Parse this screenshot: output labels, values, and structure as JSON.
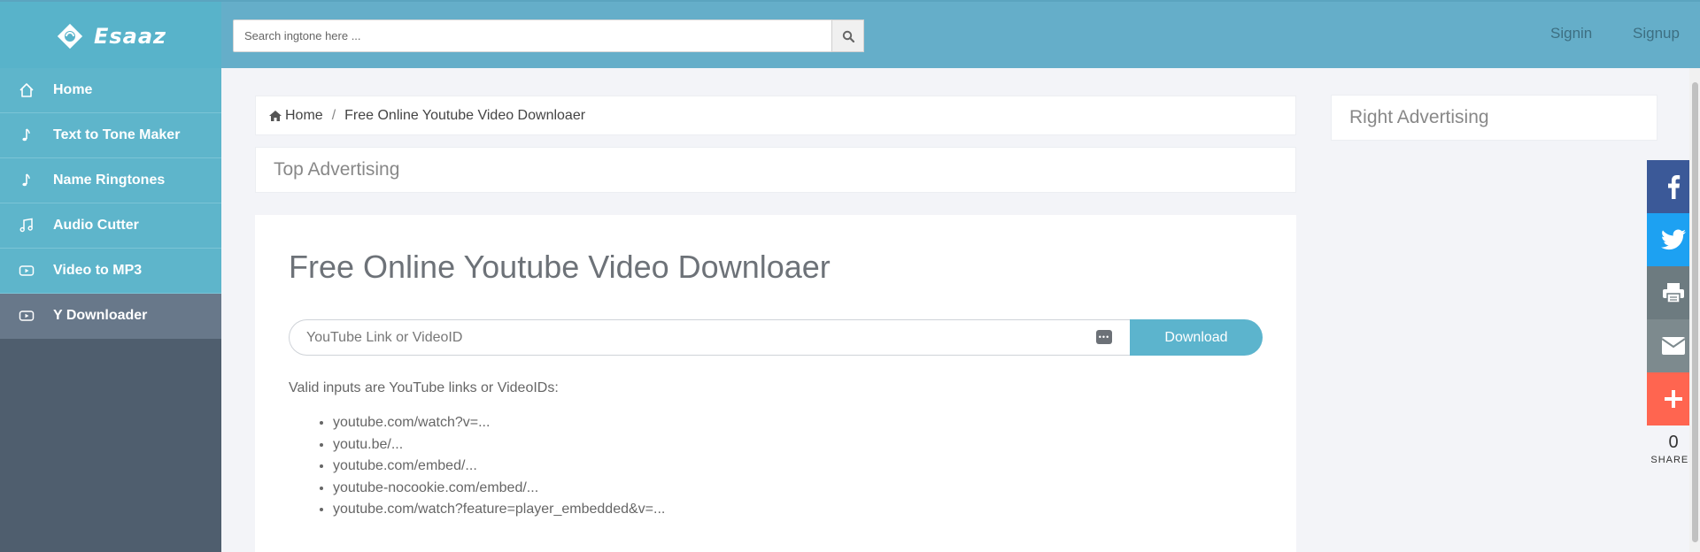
{
  "header": {
    "brand": "Esaaz",
    "search_placeholder": "Search ingtone here ...",
    "signin": "Signin",
    "signup": "Signup",
    "bar_color": "#65aec9"
  },
  "sidebar": {
    "items": [
      {
        "label": "Home",
        "icon": "home-icon"
      },
      {
        "label": "Text to Tone Maker",
        "icon": "music-note-icon"
      },
      {
        "label": "Name Ringtones",
        "icon": "music-note-icon"
      },
      {
        "label": "Audio Cutter",
        "icon": "music-notes-icon"
      },
      {
        "label": "Video to MP3",
        "icon": "video-icon"
      },
      {
        "label": "Y Downloader",
        "icon": "video-icon"
      }
    ],
    "active_index": 5
  },
  "breadcrumb": {
    "home": "Home",
    "current": "Free Online Youtube Video Downloaer"
  },
  "ads": {
    "top": "Top Advertising",
    "right": "Right Advertising"
  },
  "main": {
    "title": "Free Online Youtube Video Downloaer",
    "input_placeholder": "YouTube Link or VideoID",
    "download_label": "Download",
    "valid_text": "Valid inputs are YouTube links or VideoIDs:",
    "valid_list": [
      "youtube.com/watch?v=...",
      "youtu.be/...",
      "youtube.com/embed/...",
      "youtube-nocookie.com/embed/...",
      "youtube.com/watch?feature=player_embedded&v=..."
    ]
  },
  "share": {
    "buttons": [
      {
        "name": "facebook",
        "color": "#3b5998"
      },
      {
        "name": "twitter",
        "color": "#1da1f2"
      },
      {
        "name": "print",
        "color": "#6d7b80"
      },
      {
        "name": "email",
        "color": "#7d8a8e"
      },
      {
        "name": "more",
        "color": "#ff6550"
      }
    ],
    "count": "0",
    "label": "SHARES"
  }
}
